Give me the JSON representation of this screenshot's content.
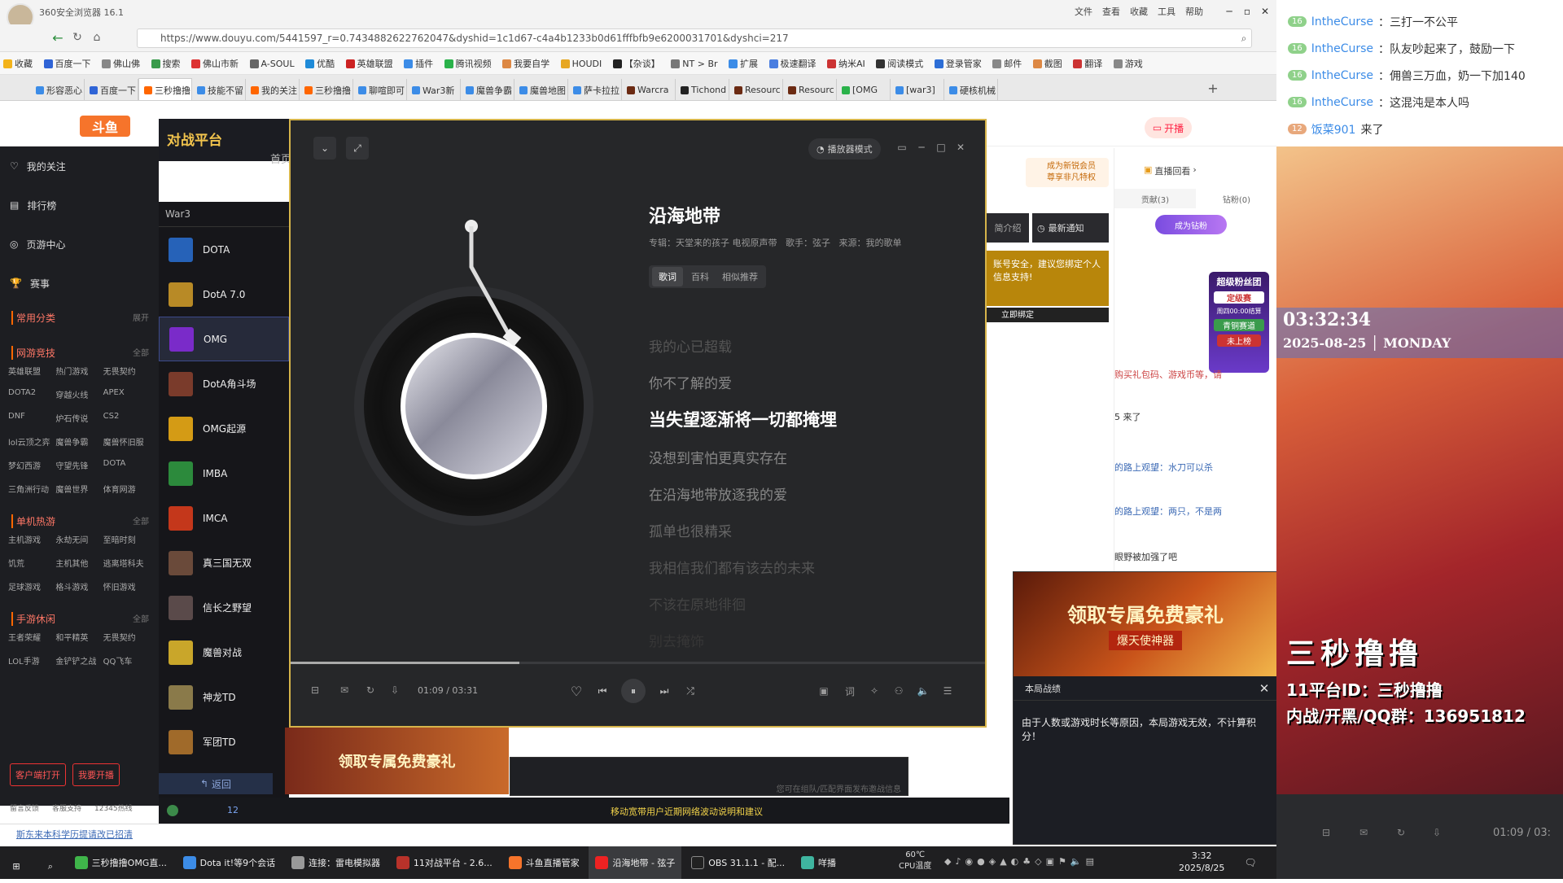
{
  "browser": {
    "app_title": "360安全浏览器 16.1",
    "menu": [
      "文件",
      "查看",
      "收藏",
      "工具",
      "帮助"
    ],
    "url": "https://www.douyu.com/5441597_r=0.7434882622762047&dyshid=1c1d67-c4a4b1233b0d61fffbfb9e6200031701&dyshci=217",
    "bookmarks": [
      "收藏",
      "百度一下",
      "佛山佛",
      "搜索",
      "佛山市新",
      "A-SOUL",
      "优酷",
      "英雄联盟",
      "插件",
      "腾讯视频",
      "我要自学",
      "HOUDI",
      "【杂谈】",
      "NT > Br",
      "扩展",
      "极速翻译",
      "纳米AI",
      "阅读模式",
      "登录管家",
      "邮件",
      "截图",
      "翻译",
      "游戏"
    ],
    "tabs": [
      "形容恶心",
      "百度一下",
      "三秒撸撸",
      "技能不留",
      "我的关注",
      "三秒撸撸",
      "聊喧即可",
      "War3新",
      "魔兽争霸",
      "魔兽地图",
      "萨卡拉拉",
      "Warcra",
      "Tichond",
      "Resourc",
      "Resourc",
      "[OMG",
      "[war3]",
      "硬核机械"
    ]
  },
  "douyu": {
    "nav": [
      "我的关注",
      "排行榜",
      "页游中心",
      "赛事"
    ],
    "common_label": "常用分类",
    "expand": "展开",
    "sections": [
      {
        "title": "网游竞技",
        "more": "全部",
        "items": [
          "英雄联盟",
          "热门游戏",
          "无畏契约",
          "DOTA2",
          "穿越火线",
          "APEX",
          "DNF",
          "炉石传说",
          "CS2",
          "lol云顶之弈",
          "魔兽争霸",
          "魔兽怀旧服",
          "梦幻西游",
          "守望先锋",
          "DOTA",
          "三角洲行动",
          "魔兽世界",
          "体育网游"
        ]
      },
      {
        "title": "单机热游",
        "more": "全部",
        "items": [
          "主机游戏",
          "永劫无间",
          "至暗时刻",
          "饥荒",
          "主机其他",
          "逃离塔科夫",
          "足球游戏",
          "格斗游戏",
          "怀旧游戏"
        ]
      },
      {
        "title": "手游休闲",
        "more": "全部",
        "items": [
          "王者荣耀",
          "和平精英",
          "无畏契约",
          "LOL手游",
          "金铲铲之战",
          "QQ飞车"
        ]
      }
    ],
    "client_open": "客户端打开",
    "go_live": "我要开播",
    "footer": [
      "留言反馈",
      "客服支持",
      "12345热线"
    ],
    "notice": "斯东来本科学历提请改已招清"
  },
  "platform": {
    "logo": "对战平台",
    "home": "首页",
    "category": "War3",
    "games": [
      "DOTA",
      "DotA 7.0",
      "OMG",
      "DotA角斗场",
      "OMG起源",
      "IMBA",
      "IMCA",
      "真三国无双",
      "信长之野望",
      "魔兽对战",
      "神龙TD",
      "军团TD"
    ],
    "back": "返回",
    "status_count": "12",
    "bottom_notice": "移动宽带用户近期网络波动说明和建议",
    "team_hint": "您可在组队/匹配界面发布邀战信息"
  },
  "player": {
    "mode_btn": "播放器模式",
    "song_title": "沿海地带",
    "meta": "专辑：天堂来的孩子 电视原声带   歌手：弦子   来源：我的歌单",
    "tabs": [
      "歌词",
      "百科",
      "相似推荐"
    ],
    "lyrics": [
      "我的心已超载",
      "你不了解的爱",
      "当失望逐渐将一切都掩埋",
      "没想到害怕更真实存在",
      "在沿海地带放逐我的爱",
      "孤单也很精采",
      "我相信我们都有该去的未来",
      "不该在原地徘徊",
      "别去掩饰"
    ],
    "time": "01:09 / 03:31",
    "progress": 0.33
  },
  "game_popup": {
    "title": "本局战绩",
    "message": "由于人数或游戏时长等原因，本局游戏无效，不计算积分！",
    "ad_text": "领取专属免费豪礼",
    "ad_sub": "爆天使神器"
  },
  "room": {
    "vip_line1": "成为新锐会员",
    "vip_line2": "尊享非凡特权",
    "go_live": "开播",
    "replay": "直播回看",
    "tab_contrib": "贡献(3)",
    "tab_diamond": "钻粉(0)",
    "become_fan": "成为钻粉",
    "intro": "简介绍",
    "latest": "最新通知",
    "bind_tip": "账号安全，建议您绑定个人信息支持!",
    "bind_now": "立即绑定",
    "fan_group": "超级粉丝团",
    "fan_event": "定级赛",
    "fan_time": "周四00:00结算",
    "fan_join": "青铜赛道",
    "fan_rank": "未上榜",
    "chat_partial": [
      "购买礼包码、游戏币等，请",
      "5 来了",
      "的路上观望：水刀可以杀",
      "的路上观望：两只，不是两",
      "眼野被加强了吧"
    ]
  },
  "right_chat": [
    {
      "lv": "16",
      "user": "IntheCurse",
      "text": "：三打一不公平"
    },
    {
      "lv": "16",
      "user": "IntheCurse",
      "text": "：队友吵起来了，鼓励一下"
    },
    {
      "lv": "16",
      "user": "IntheCurse",
      "text": "：佣兽三万血，奶一下加140"
    },
    {
      "lv": "16",
      "user": "IntheCurse",
      "text": "：这混沌是本人吗"
    },
    {
      "lv": "12",
      "user": "饭菜901",
      "text": " 来了"
    }
  ],
  "stream": {
    "clock": "03:32:34",
    "date": "2025-08-25 │ MONDAY",
    "streamer": "三秒撸撸",
    "id_line": "11平台ID：三秒撸撸",
    "qq_line": "内战/开黑/QQ群：136951812",
    "time": "01:09 / 03:"
  },
  "taskbar": {
    "apps": [
      "三秒撸撸OMG直...",
      "Dota it!等9个会话",
      "连接：雷电模拟器",
      "11对战平台 - 2.6...",
      "斗鱼直播管家",
      "沿海地带 - 弦子",
      "OBS 31.1.1 - 配...",
      "咩播"
    ],
    "temp": "60℃",
    "temp_label": "CPU温度",
    "time": "3:32",
    "date": "2025/8/25"
  }
}
